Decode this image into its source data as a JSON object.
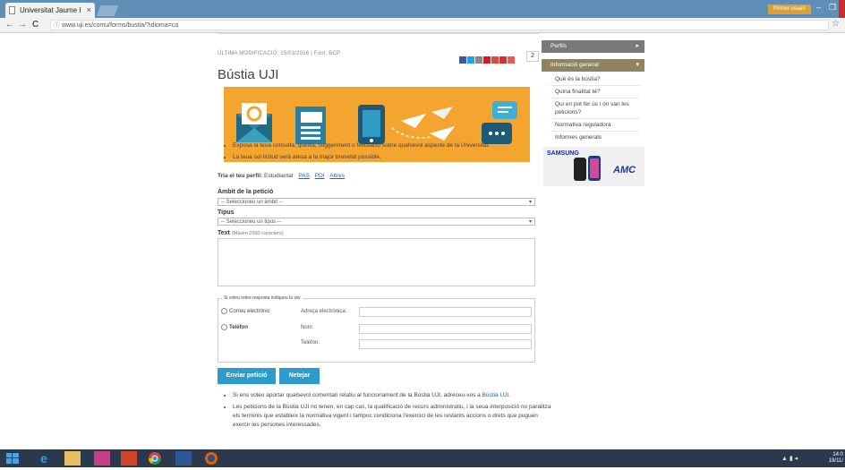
{
  "browser": {
    "tab_title": "Universitat Jaume I",
    "tab_close": "×",
    "url": "www.uji.es/comu/forms/bustia/?idioma=ca",
    "user_label": "Primer usuari",
    "back": "←",
    "forward": "→",
    "reload": "C",
    "info": "ⓘ",
    "bookmark": "☆",
    "win_min": "–",
    "win_max": "❐"
  },
  "page": {
    "meta": "ÚLTIMA MODIFICACIÓ: 15/03/2016 | Font: BCP",
    "share_count": "2",
    "title": "Bústia UJI",
    "bullets": [
      "Exposa la teua consulta, queixa, suggeriment o felicitació sobre qualsevol aspecte de la Universitat.",
      "La teua sol·licitud serà atesa a la major brevetat possible."
    ],
    "profile": {
      "label": "Tria el teu perfil:",
      "current": "Estudiantat",
      "options": [
        "PAS",
        "PDI",
        "Altres"
      ]
    },
    "ambit": {
      "label": "Àmbit de la petició",
      "value": "-- Seleccioneu un àmbit --"
    },
    "tipus": {
      "label": "Tipus",
      "value": "-- Seleccioneu un tipus --"
    },
    "text": {
      "label": "Text",
      "hint": "(Màxim 2000 caràcters)"
    },
    "response": {
      "legend": "Si voleu rebre resposta indiqueu la via:",
      "email_option": "Correu electrònic",
      "email_field": "Adreça electrònica:",
      "phone_option": "Telèfon",
      "name_field": "Nom:",
      "phone_field": "Telèfon:"
    },
    "buttons": {
      "send": "Enviar petició",
      "clear": "Netejar"
    },
    "notes": {
      "note1_text": "Si ens voleu aportar qualsevol comentari relatiu al funcionament de la Bústia UJI, adreceu-vos a ",
      "note1_link": "Bústia UJI",
      "note1_end": ".",
      "note2": "Les peticions de la Bústia UJI no tenen, en cap cas, la qualificació de recurs administratiu, i la seua interposició no paralitza els terminis que estableix la normativa vigent i tampoc condiciona l'exercici de les restants accions o drets que puguen exercir les persones interessades."
    }
  },
  "sidebar": {
    "perfils": "Perfils",
    "info_header": "Informació general",
    "links": [
      "Què és la bústia?",
      "Quina finalitat té?",
      "Qui en pot fer ús i on van les peticions?",
      "Normativa reguladora",
      "Informes generals"
    ],
    "ad_brand": "SAMSUNG",
    "ad_logo": "AMC"
  },
  "taskbar": {
    "time": "14:0",
    "date": "18/11/"
  },
  "colors": {
    "accent_blue": "#2d9ccc",
    "banner_orange": "#f4a530",
    "sidebar_gray": "#7a7a7a",
    "sidebar_gold": "#8f8460"
  }
}
